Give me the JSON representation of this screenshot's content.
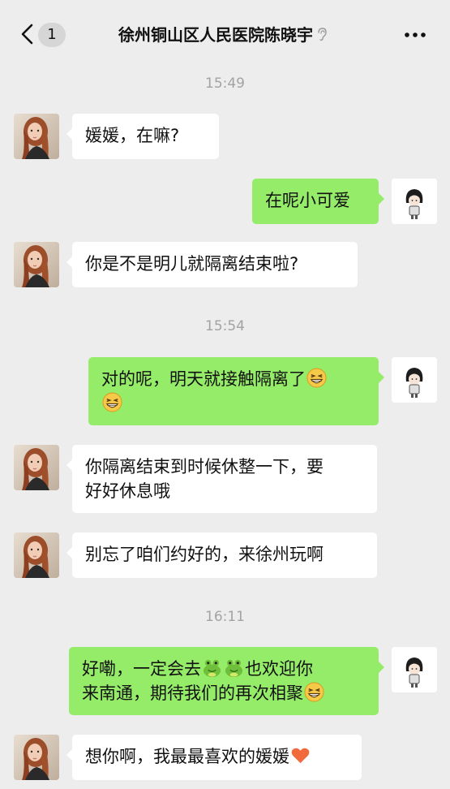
{
  "header": {
    "back_count": "1",
    "title": "徐州铜山区人民医院陈晓宇"
  },
  "messages": [
    {
      "type": "time",
      "text": "15:49"
    },
    {
      "type": "in",
      "text": "媛媛，在嘛?"
    },
    {
      "type": "out",
      "text": "在呢小可爱"
    },
    {
      "type": "in",
      "text": "你是不是明儿就隔离结束啦?"
    },
    {
      "type": "time",
      "text": "15:54"
    },
    {
      "type": "out",
      "line1": "对的呢，明天就接触隔离了",
      "emoji": "grinning-face-emoji"
    },
    {
      "type": "in",
      "line1": "你隔离结束到时候休整一下，要",
      "line2": "好好休息哦"
    },
    {
      "type": "in",
      "text": "别忘了咱们约好的，来徐州玩啊"
    },
    {
      "type": "time",
      "text": "16:11"
    },
    {
      "type": "out",
      "part1": "好嘞，一定会去",
      "part2": "也欢迎你",
      "line2": "来南通，期待我们的再次相聚",
      "emoji_a": "frog-emoji",
      "emoji_b": "grinning-face-emoji"
    },
    {
      "type": "in",
      "text": "想你啊，我最最喜欢的媛媛",
      "emoji": "orange-heart-emoji"
    }
  ],
  "colors": {
    "background": "#ededed",
    "incoming_bubble": "#ffffff",
    "outgoing_bubble": "#95ec69",
    "timestamp": "#a3a3a3"
  }
}
